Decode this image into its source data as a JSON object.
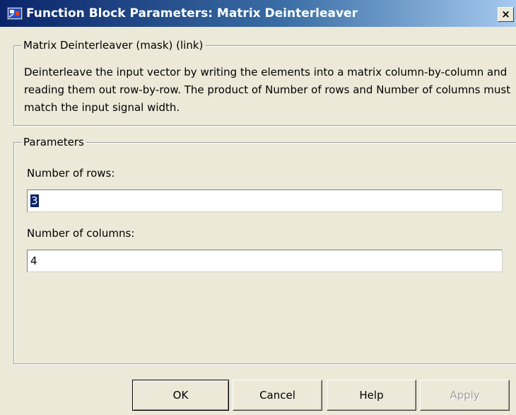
{
  "window": {
    "title": "Function Block Parameters: Matrix Deinterleaver",
    "close_label": "×",
    "app_icon": "simulink-block-icon"
  },
  "description": {
    "legend": "Matrix Deinterleaver (mask) (link)",
    "text": "Deinterleave the input vector by writing the elements into a matrix column-by-column and reading them out row-by-row.  The product of Number of rows and Number of columns must match the input signal width."
  },
  "parameters": {
    "legend": "Parameters",
    "rows_label": "Number of rows:",
    "rows_value": "3",
    "columns_label": "Number of columns:",
    "columns_value": "4"
  },
  "buttons": {
    "ok": "OK",
    "cancel": "Cancel",
    "help": "Help",
    "apply": "Apply"
  },
  "colors": {
    "titlebar_start": "#0a246a",
    "titlebar_end": "#a6caf0",
    "dialog_bg": "#ece9d8",
    "selection": "#0a246a"
  }
}
